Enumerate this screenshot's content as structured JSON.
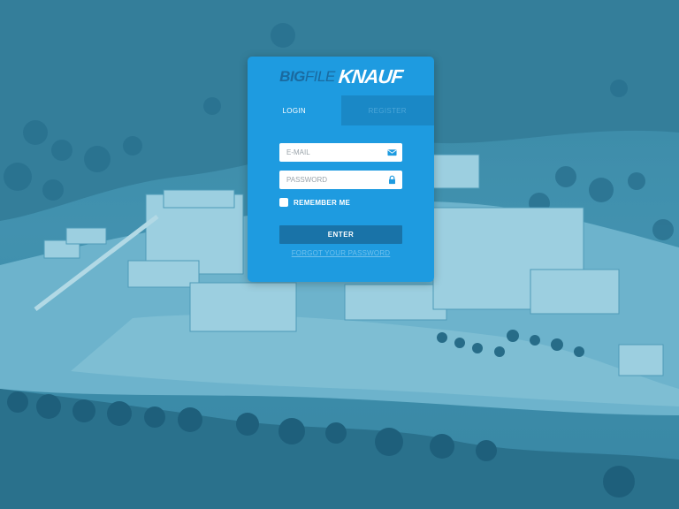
{
  "logo": {
    "big": "BIG",
    "file": "FILE",
    "brand": "KNAUF"
  },
  "tabs": [
    {
      "label": "LOGIN",
      "active": true
    },
    {
      "label": "REGISTER",
      "active": false
    }
  ],
  "form": {
    "email_placeholder": "E-MAIL",
    "email_icon": "envelope-icon",
    "password_placeholder": "PASSWORD",
    "password_icon": "lock-icon",
    "remember_label": "REMEMBER ME",
    "remember_checked": false,
    "enter_label": "ENTER",
    "forgot_label": "FORGOT YOUR PASSWORD"
  },
  "colors": {
    "card": "#1e9be0",
    "button": "#1973a8",
    "background_tint": "#3f8aa8"
  }
}
